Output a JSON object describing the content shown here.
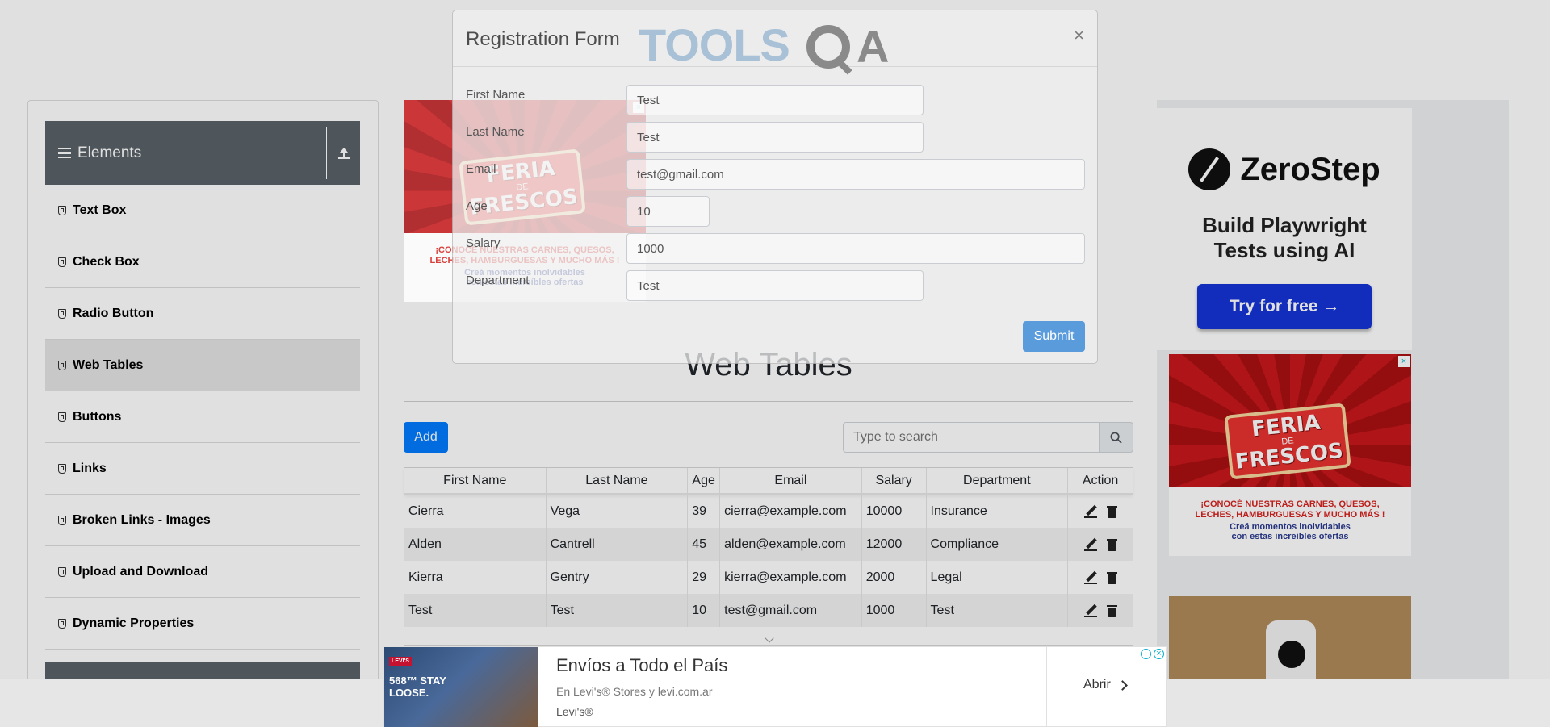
{
  "sidebar": {
    "group_title": "Elements",
    "items": [
      {
        "label": "Text Box"
      },
      {
        "label": "Check Box"
      },
      {
        "label": "Radio Button"
      },
      {
        "label": "Web Tables"
      },
      {
        "label": "Buttons"
      },
      {
        "label": "Links"
      },
      {
        "label": "Broken Links - Images"
      },
      {
        "label": "Upload and Download"
      },
      {
        "label": "Dynamic Properties"
      }
    ],
    "active_item": "Web Tables"
  },
  "main": {
    "title": "Web Tables",
    "add_label": "Add",
    "search": {
      "placeholder": "Type to search",
      "value": ""
    },
    "table": {
      "headers": [
        "First Name",
        "Last Name",
        "Age",
        "Email",
        "Salary",
        "Department",
        "Action"
      ],
      "rows": [
        [
          "Cierra",
          "Vega",
          "39",
          "cierra@example.com",
          "10000",
          "Insurance"
        ],
        [
          "Alden",
          "Cantrell",
          "45",
          "alden@example.com",
          "12000",
          "Compliance"
        ],
        [
          "Kierra",
          "Gentry",
          "29",
          "kierra@example.com",
          "2000",
          "Legal"
        ],
        [
          "Test",
          "Test",
          "10",
          "test@gmail.com",
          "1000",
          "Test"
        ]
      ]
    }
  },
  "modal": {
    "title": "Registration Form",
    "logo_text": "TOOLS",
    "logo_suffix": "A",
    "close_glyph": "×",
    "fields": {
      "first_name": {
        "label": "First Name",
        "value": "Test"
      },
      "last_name": {
        "label": "Last Name",
        "value": "Test"
      },
      "email": {
        "label": "Email",
        "value": "test@gmail.com"
      },
      "age": {
        "label": "Age",
        "value": "10"
      },
      "salary": {
        "label": "Salary",
        "value": "1000"
      },
      "department": {
        "label": "Department",
        "value": "Test"
      }
    },
    "submit_label": "Submit"
  },
  "ads": {
    "zerostep": {
      "brand": "ZeroStep",
      "tagline_1": "Build Playwright",
      "tagline_2": "Tests using AI",
      "cta": "Try for free →",
      "cta_color": "#1533d6"
    },
    "feria": {
      "title_1": "FERIA",
      "title_de": "DE",
      "title_2": "FRESCOS",
      "line_1": "¡CONOCÉ NUESTRAS CARNES, QUESOS,",
      "line_2": "LECHES, HAMBURGUESAS Y MUCHO MÁS !",
      "line_3": "Creá momentos inolvidables",
      "line_4": "con estas increíbles ofertas"
    },
    "levis": {
      "image_tag": "LEVI'S",
      "image_text_1": "568™ STAY",
      "image_text_2": "LOOSE.",
      "title": "Envíos a Todo el País",
      "subtitle": "En Levi's® Stores y levi.com.ar",
      "brand": "Levi's®",
      "cta": "Abrir"
    },
    "adchoices_info": "i",
    "adchoices_close": "×"
  }
}
